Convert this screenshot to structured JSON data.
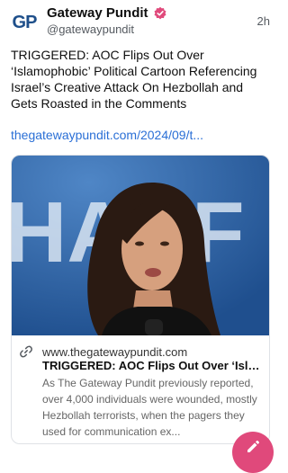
{
  "author": {
    "display_name": "Gateway Pundit",
    "handle": "@gatewaypundit",
    "avatar_text": "GP",
    "timestamp": "2h",
    "verified": true
  },
  "post": {
    "text": "TRIGGERED: AOC Flips Out Over ‘Islamophobic’ Political Cartoon Referencing Israel’s Creative Attack On Hezbollah and Gets Roasted in the Comments",
    "link": "thegatewaypundit.com/2024/09/t..."
  },
  "card": {
    "image_text": "HARF",
    "domain": "www.thegatewaypundit.com",
    "title": "TRIGGERED: AOC Flips Out Over ‘Isla...",
    "description": "As The Gateway Pundit previously reported, over 4,000 individuals were wounded, mostly Hezbollah terrorists, when the pagers they used for communication ex..."
  },
  "icons": {
    "verified": "verified-badge-icon",
    "link": "link-icon",
    "compose": "compose-icon"
  },
  "colors": {
    "link": "#2a6fd6",
    "verified": "#e0497b",
    "fab": "#e0497b",
    "avatar": "#1e4f8a",
    "image_bg": "#2e63a6"
  }
}
